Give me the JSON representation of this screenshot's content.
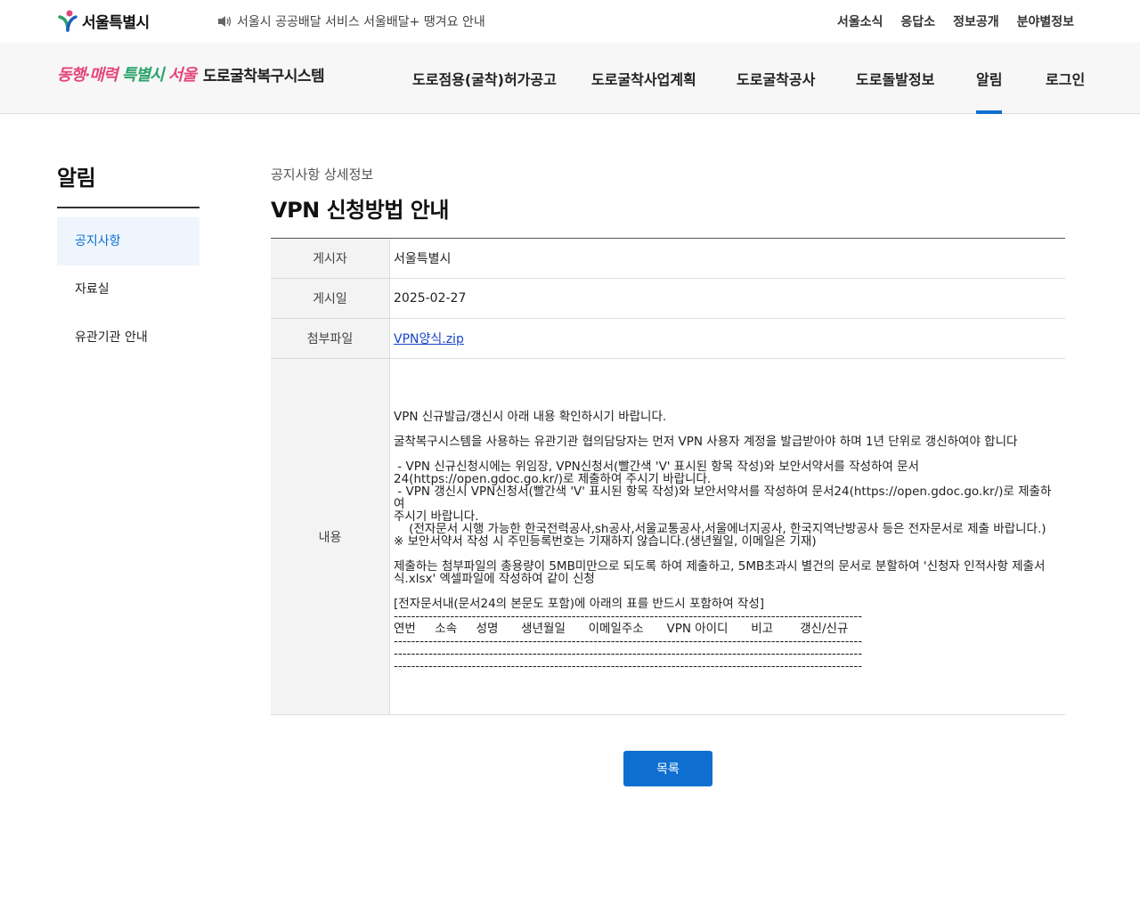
{
  "topbar": {
    "logo_text": "서울특별시",
    "notice_text": "서울시 공공배달 서비스 서울배달+ 땡겨요 안내",
    "links": [
      "서울소식",
      "응답소",
      "정보공개",
      "분야별정보"
    ]
  },
  "header": {
    "slogan_part1": "동행·매력",
    "slogan_part2": "특별시",
    "slogan_part3": "서울",
    "system_name": "도로굴착복구시스템",
    "nav": [
      "도로점용(굴착)허가공고",
      "도로굴착사업계획",
      "도로굴착공사",
      "도로돌발정보",
      "알림",
      "로그인"
    ],
    "active_nav": "알림"
  },
  "sidebar": {
    "title": "알림",
    "items": [
      {
        "label": "공지사항",
        "active": true
      },
      {
        "label": "자료실",
        "active": false
      },
      {
        "label": "유관기관 안내",
        "active": false
      }
    ]
  },
  "main": {
    "breadcrumb": "공지사항 상세정보",
    "title": "VPN 신청방법 안내",
    "fields": {
      "author_label": "게시자",
      "author_value": "서울특별시",
      "date_label": "게시일",
      "date_value": "2025-02-27",
      "file_label": "첨부파일",
      "file_value": "VPN양식.zip",
      "content_label": "내용"
    },
    "content": {
      "p1": "VPN 신규발급/갱신시 아래 내용 확인하시기 바랍니다.",
      "p2": "굴착복구시스템을 사용하는 유관기관 협의담당자는 먼저 VPN 사용자 계정을 발급받아야 하며 1년 단위로 갱신하여야 합니다",
      "p3": " - VPN 신규신청시에는 위임장, VPN신청서(빨간색 'V' 표시된 항목 작성)와 보안서약서를 작성하여 문서\n24(https://open.gdoc.go.kr/)로 제출하여 주시기 바랍니다.\n - VPN 갱신시 VPN신청서(빨간색 'V' 표시된 항목 작성)와 보안서약서를 작성하여 문서24(https://open.gdoc.go.kr/)로 제출하여\n주시기 바랍니다.\n    (전자문서 시행 가능한 한국전력공사,sh공사,서울교통공사,서울에너지공사, 한국지역난방공사 등은 전자문서로 제출 바랍니다.)\n※ 보안서약서 작성 시 주민등록번호는 기재하지 않습니다.(생년월일, 이메일은 기재)",
      "p4": "제출하는 첨부파일의 총용량이 5MB미만으로 되도록 하여 제출하고, 5MB초과시 별건의 문서로 분할하여 '신청자 인적사항 제출서\n식.xlsx' 엑셀파일에 작성하여 같이 신청",
      "p5": "[전자문서내(문서24의 본문도 포함)에 아래의 표를 반드시 포함하여 작성]\n------------------------------------------------------------------------------------------------------------\n연번     소속     성명      생년월일      이메일주소      VPN 아이디      비고       갱신/신규\n------------------------------------------------------------------------------------------------------------\n------------------------------------------------------------------------------------------------------------\n------------------------------------------------------------------------------------------------------------"
    },
    "list_button": "목록"
  }
}
